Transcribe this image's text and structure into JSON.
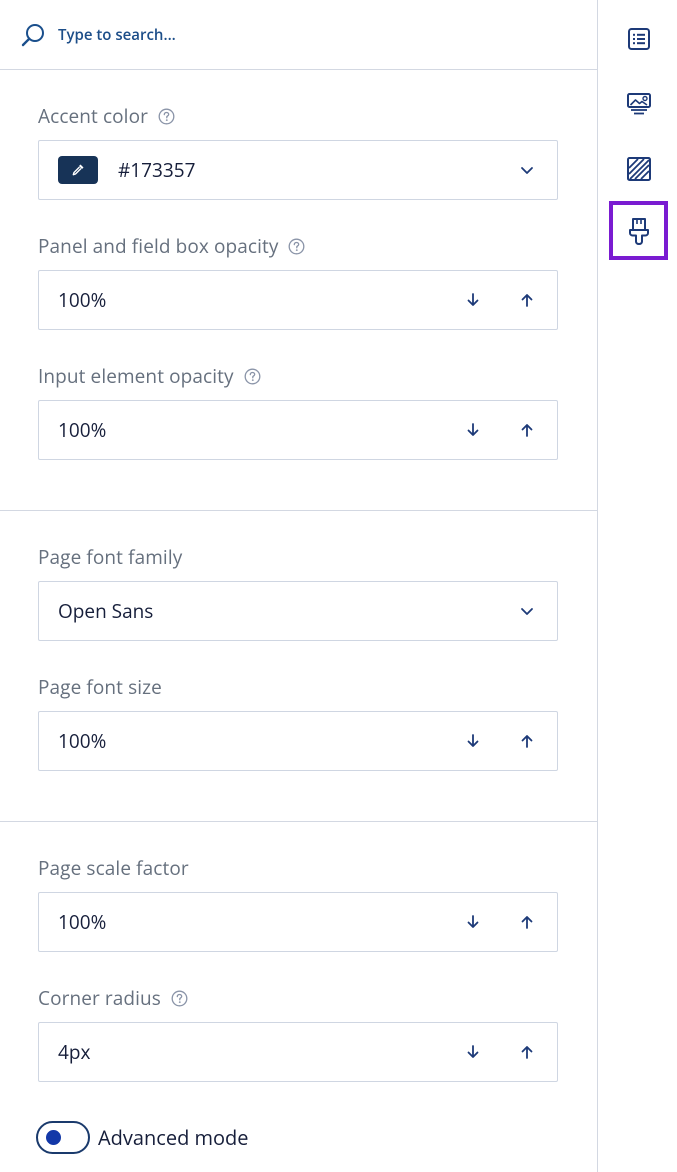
{
  "search": {
    "placeholder": "Type to search..."
  },
  "colors": {
    "accent": "#173357",
    "highlight": "#7a1bd1"
  },
  "fields": {
    "accent_color": {
      "label": "Accent color",
      "value": "#173357"
    },
    "panel_opacity": {
      "label": "Panel and field box opacity",
      "value": "100%"
    },
    "input_opacity": {
      "label": "Input element opacity",
      "value": "100%"
    },
    "font_family": {
      "label": "Page font family",
      "value": "Open Sans"
    },
    "font_size": {
      "label": "Page font size",
      "value": "100%"
    },
    "scale_factor": {
      "label": "Page scale factor",
      "value": "100%"
    },
    "corner_radius": {
      "label": "Corner radius",
      "value": "4px"
    }
  },
  "advanced_mode": {
    "label": "Advanced mode",
    "enabled": false
  },
  "sidebar": {
    "items": [
      {
        "icon": "list-icon",
        "active": false
      },
      {
        "icon": "image-settings-icon",
        "active": false
      },
      {
        "icon": "pattern-icon",
        "active": false
      },
      {
        "icon": "paint-brush-icon",
        "active": true
      }
    ]
  }
}
